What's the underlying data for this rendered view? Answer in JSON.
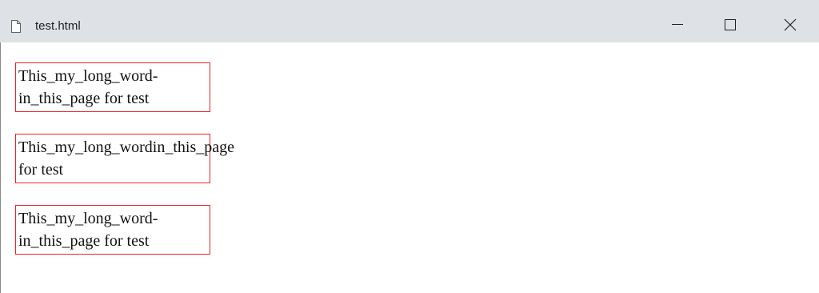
{
  "window": {
    "title": "test.html",
    "controls": {
      "minimize_icon": "minimize-icon",
      "maximize_icon": "maximize-icon",
      "close_icon": "close-icon"
    },
    "file_icon": "document-icon"
  },
  "content": {
    "box_border_color": "#e8242a",
    "blocks": [
      {
        "lines": [
          "This_my_long_word-",
          "in_this_page for test"
        ]
      },
      {
        "lines": [
          "This_my_long_wordin_this_page",
          "for test"
        ]
      },
      {
        "lines": [
          "This_my_long_word-",
          "in_this_page for test"
        ]
      }
    ]
  }
}
